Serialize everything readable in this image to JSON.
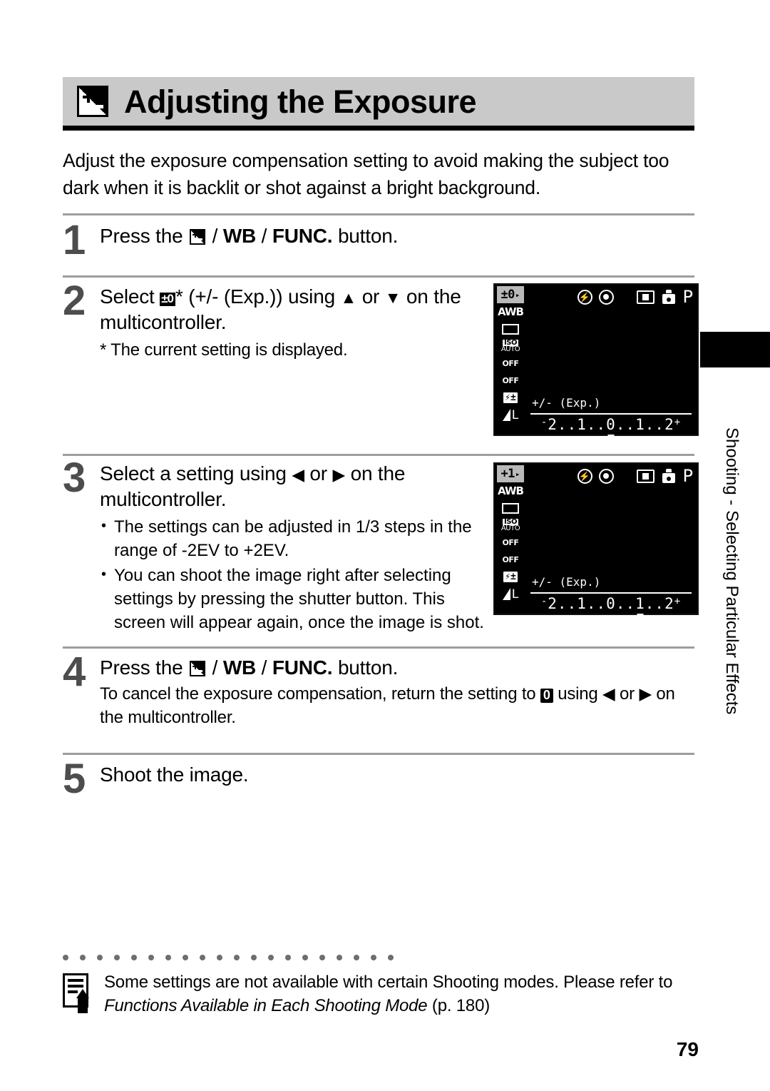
{
  "header": {
    "icon": "exposure-compensation-icon",
    "title": "Adjusting the Exposure"
  },
  "intro": "Adjust the exposure compensation setting to avoid making the subject too dark when it is backlit or shot against a bright background.",
  "steps": [
    {
      "number": "1",
      "head_before": "Press the ",
      "head_sep1": " / ",
      "head_wb": "WB",
      "head_sep2": " / ",
      "head_func": "FUNC.",
      "head_after": " button."
    },
    {
      "number": "2",
      "head_before": "Select ",
      "head_mid": "* (+/-  (Exp.)) using ",
      "up_arrow": "▲",
      "head_or": " or ",
      "down_arrow": "▼",
      "head_after": " on the multicontroller.",
      "sub": "* The current setting is displayed."
    },
    {
      "number": "3",
      "head_before": "Select a setting using ",
      "left_arrow": "◀",
      "head_or": " or ",
      "right_arrow": "▶",
      "head_after": " on the multicontroller.",
      "bullets": [
        "The settings can be adjusted in 1/3 steps in the range of -2EV to +2EV.",
        "You can shoot the image right after selecting settings by pressing the shutter button.  This screen will appear again, once the image is shot."
      ]
    },
    {
      "number": "4",
      "head_before": "Press the ",
      "head_sep1": " / ",
      "head_wb": "WB",
      "head_sep2": " / ",
      "head_func": "FUNC.",
      "head_after": " button.",
      "sub_before": "To cancel the exposure compensation, return the setting to ",
      "sub_zero": "0",
      "sub_using": " using ",
      "left_arrow": "◀",
      "sub_or": " or ",
      "right_arrow": "▶",
      "sub_after": " on the multicontroller."
    },
    {
      "number": "5",
      "head": "Shoot the image."
    }
  ],
  "lcd_screens": [
    {
      "name": "screen-step2",
      "selected_value": "±0",
      "caret": "▸",
      "left_icons": [
        {
          "name": "exposure-value-icon",
          "label": "±0"
        },
        {
          "name": "white-balance-awb-icon",
          "label": "AWB"
        },
        {
          "name": "drive-single-icon",
          "label": ""
        },
        {
          "name": "iso-auto-icon",
          "label": "ISO AUTO"
        },
        {
          "name": "timer-off-icon",
          "label": "OFF"
        },
        {
          "name": "aeb-off-icon",
          "label": "OFF"
        },
        {
          "name": "flash-exposure-icon",
          "label": "±"
        },
        {
          "name": "image-quality-large-icon",
          "label": "L"
        }
      ],
      "top_icons": [
        {
          "name": "flash-off-icon"
        },
        {
          "name": "red-eye-reduction-icon"
        },
        {
          "name": "metering-mode-icon"
        },
        {
          "name": "camera-icon"
        },
        {
          "name": "shooting-mode-p-icon",
          "label": "P"
        }
      ],
      "function_label": "+/- (Exp.)",
      "scale": "⁻2..1..0..1..2⁺",
      "scale_parts": {
        "minus_sup": "-",
        "left_two": "2",
        "dots1": "..",
        "left_one": "1",
        "dots2": "..",
        "zero": "0",
        "dots3": "..",
        "right_one": "1",
        "dots4": "..",
        "right_two": "2",
        "plus_sup": "+"
      },
      "cursor_position": "zero"
    },
    {
      "name": "screen-step3",
      "selected_value": "+1",
      "caret": "▸",
      "left_icons": [
        {
          "name": "exposure-value-icon",
          "label": "+1"
        },
        {
          "name": "white-balance-awb-icon",
          "label": "AWB"
        },
        {
          "name": "drive-single-icon",
          "label": ""
        },
        {
          "name": "iso-auto-icon",
          "label": "ISO AUTO"
        },
        {
          "name": "timer-off-icon",
          "label": "OFF"
        },
        {
          "name": "aeb-off-icon",
          "label": "OFF"
        },
        {
          "name": "flash-exposure-icon",
          "label": "±"
        },
        {
          "name": "image-quality-large-icon",
          "label": "L"
        }
      ],
      "top_icons": [
        {
          "name": "flash-off-icon"
        },
        {
          "name": "red-eye-reduction-icon"
        },
        {
          "name": "metering-mode-icon"
        },
        {
          "name": "camera-icon"
        },
        {
          "name": "shooting-mode-p-icon",
          "label": "P"
        }
      ],
      "function_label": "+/- (Exp.)",
      "scale": "⁻2..1..0..1..2⁺",
      "scale_parts": {
        "minus_sup": "-",
        "left_two": "2",
        "dots1": "..",
        "left_one": "1",
        "dots2": "..",
        "zero": "0",
        "dots3": "..",
        "right_one": "1",
        "dots4": "..",
        "right_two": "2",
        "plus_sup": "+"
      },
      "cursor_position": "right_one"
    }
  ],
  "side_tab": {
    "label": "Shooting - Selecting Particular Effects"
  },
  "footer_note": {
    "icon": "memo-note-icon",
    "line1": "Some settings are not available with certain Shooting modes. Please refer to",
    "italic_part": "Functions Available in Each Shooting Mode",
    "page_ref": " (p. 180)"
  },
  "page_number": "79",
  "colors": {
    "header_band": "#c9c9c9",
    "rule": "#9d9d9d",
    "step_number": "#4d4d4d",
    "lcd_background": "#000000",
    "lcd_foreground": "#ffffff",
    "lcd_selected": "#b9b9b9"
  }
}
